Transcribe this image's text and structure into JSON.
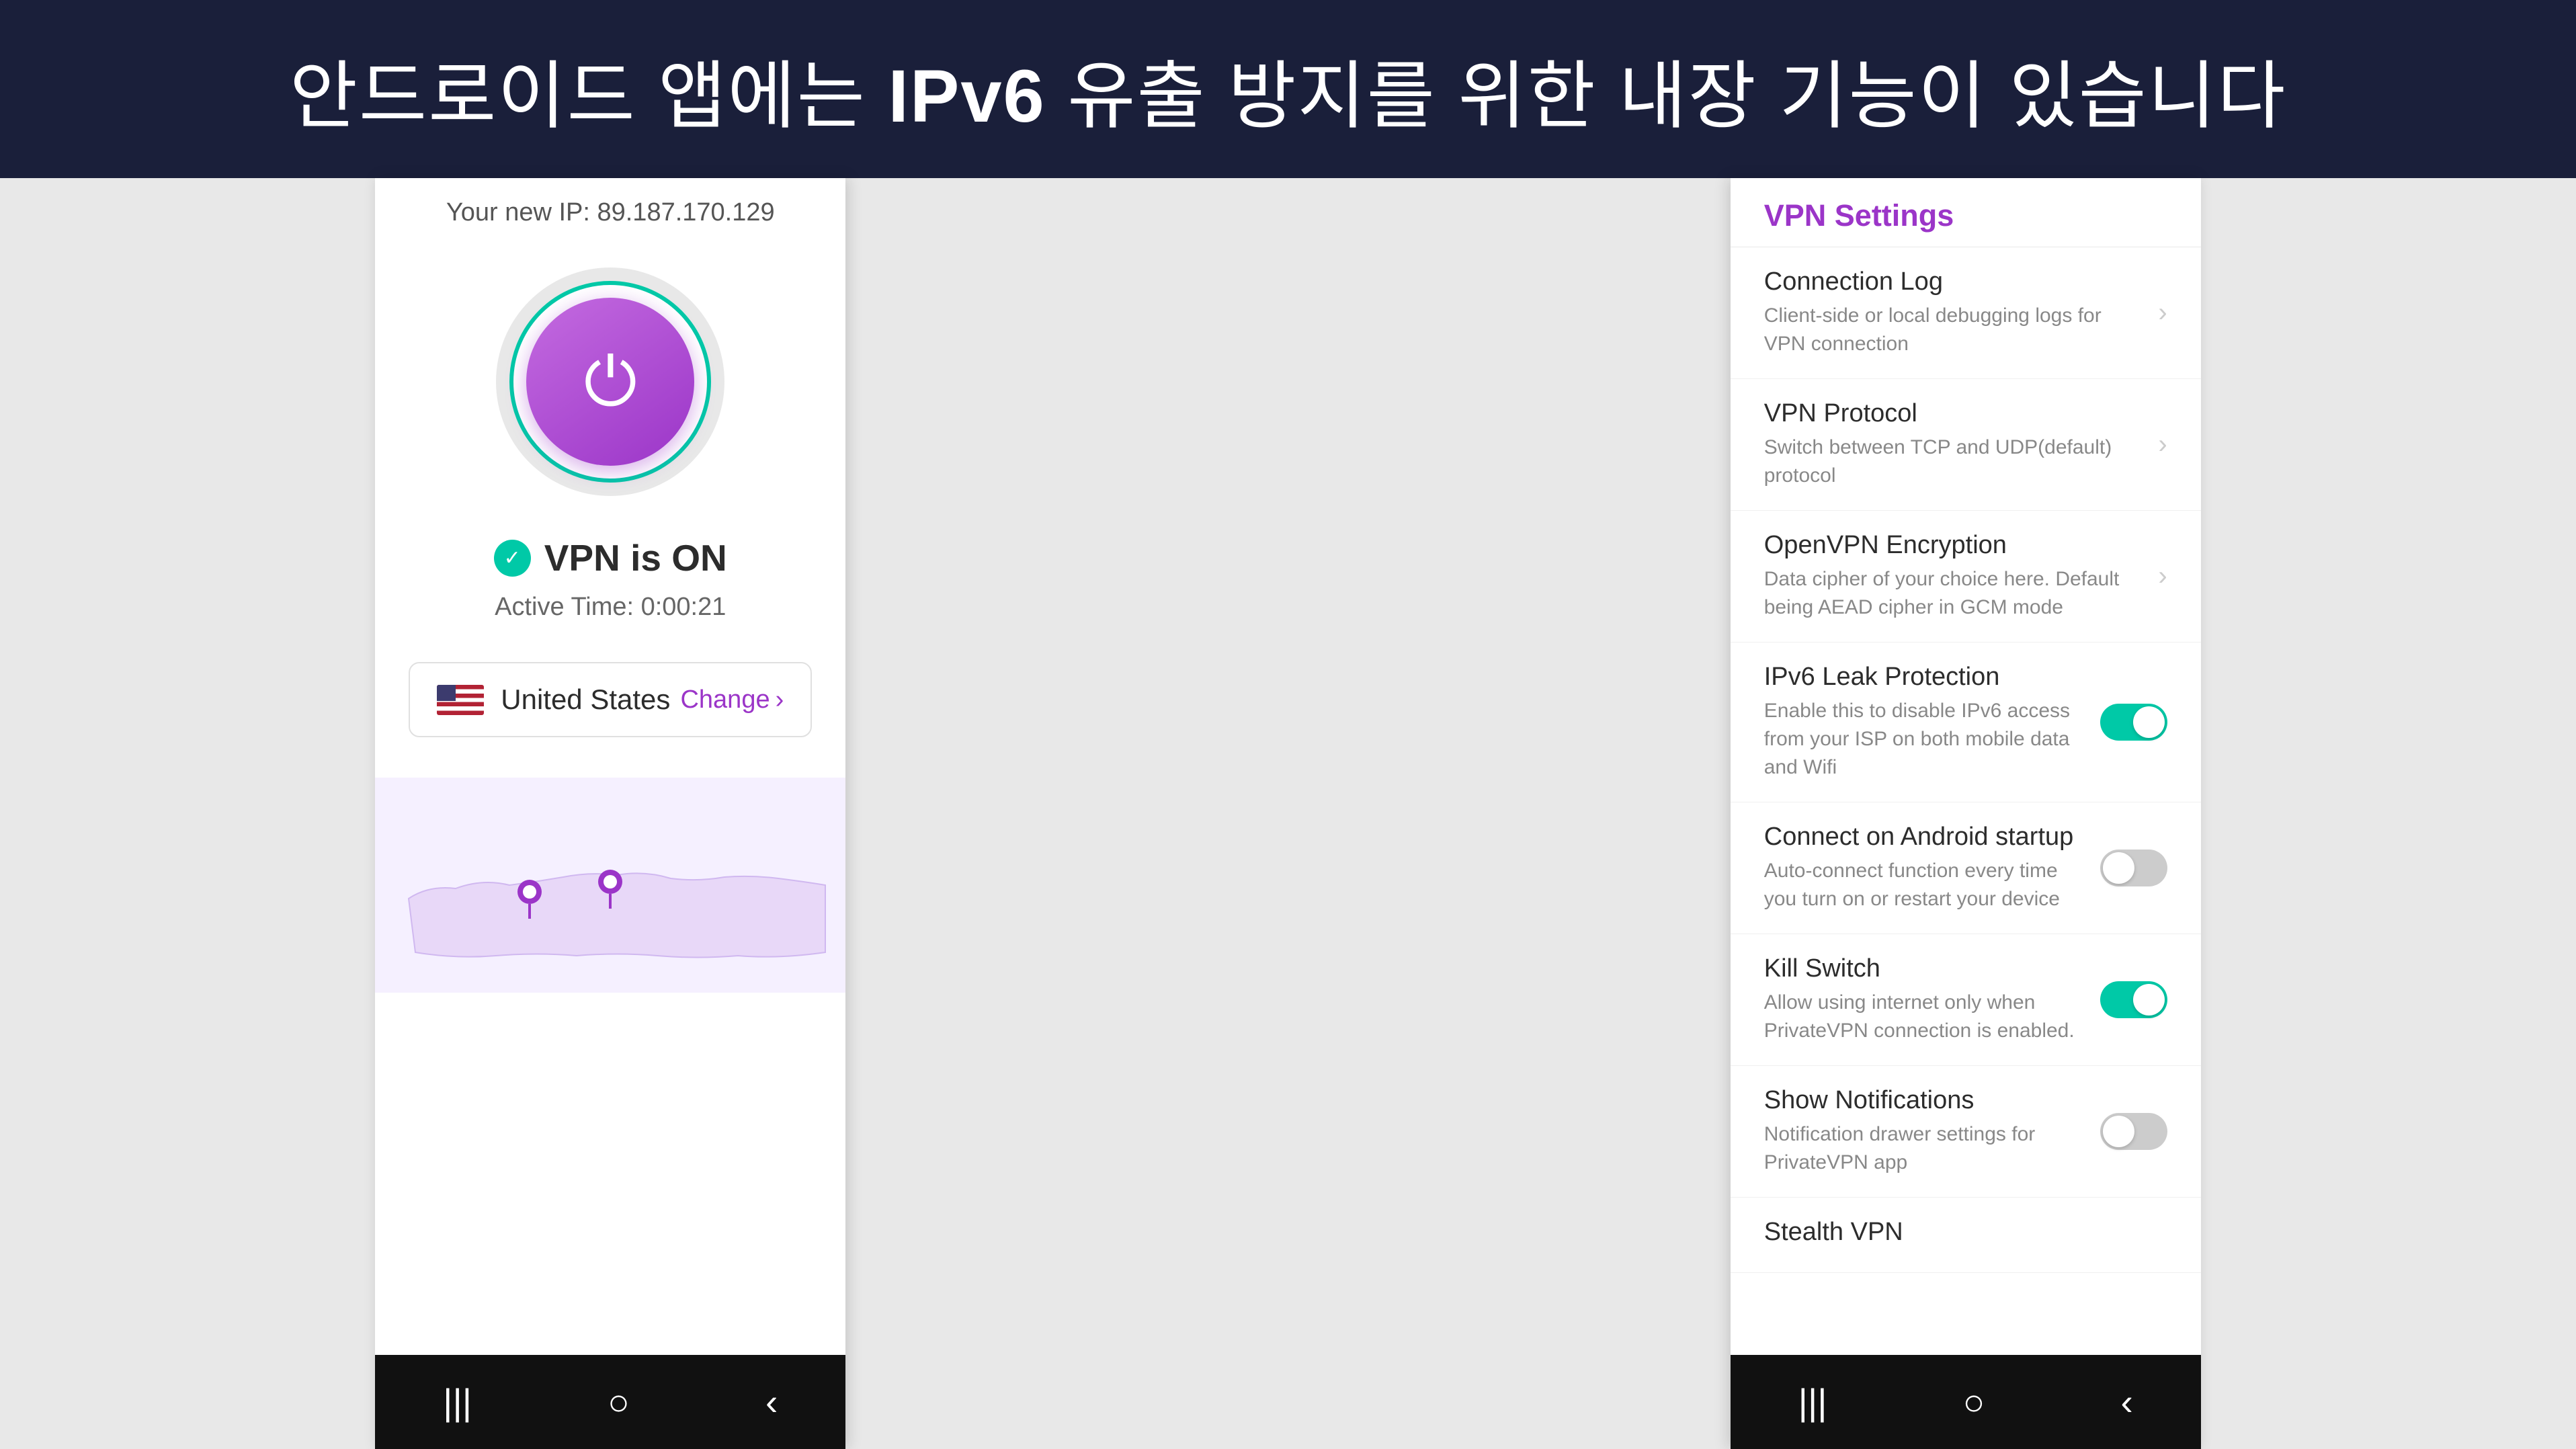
{
  "banner": {
    "text_part1": "안드로이드 앱에는 ",
    "text_bold": "IPv6",
    "text_part2": " 유출 방지를 위한 내장 기능이 있습니다"
  },
  "left_phone": {
    "ip_label": "Your new IP: 89.187.170.129",
    "vpn_status": "VPN is ON",
    "active_time": "Active Time: 0:00:21",
    "location": {
      "country": "United States",
      "change_label": "Change"
    }
  },
  "right_phone": {
    "settings_title": "VPN Settings",
    "items": [
      {
        "title": "Connection Log",
        "desc": "Client-side or local debugging logs for VPN connection",
        "type": "chevron"
      },
      {
        "title": "VPN Protocol",
        "desc": "Switch between TCP and UDP(default) protocol",
        "type": "chevron"
      },
      {
        "title": "OpenVPN Encryption",
        "desc": "Data cipher of your choice here. Default being AEAD cipher in GCM mode",
        "type": "chevron"
      },
      {
        "title": "IPv6 Leak Protection",
        "desc": "Enable this to disable IPv6 access from your ISP on both mobile data and Wifi",
        "type": "toggle",
        "toggle_state": "on"
      },
      {
        "title": "Connect on Android startup",
        "desc": "Auto-connect function every time you turn on or restart your device",
        "type": "toggle",
        "toggle_state": "off"
      },
      {
        "title": "Kill Switch",
        "desc": "Allow using internet only when PrivateVPN connection is enabled.",
        "type": "toggle",
        "toggle_state": "on"
      },
      {
        "title": "Show Notifications",
        "desc": "Notification drawer settings for PrivateVPN app",
        "type": "toggle",
        "toggle_state": "off"
      },
      {
        "title": "Stealth VPN",
        "desc": "",
        "type": "partial"
      }
    ]
  },
  "nav_icons": {
    "menu": "|||",
    "home": "○",
    "back": "‹"
  }
}
